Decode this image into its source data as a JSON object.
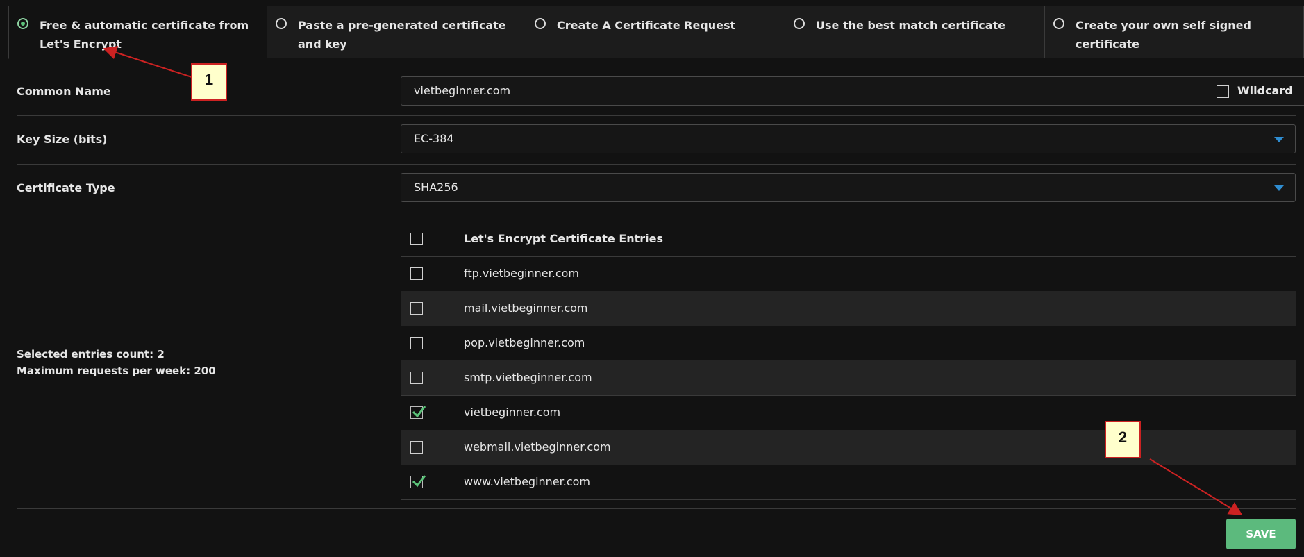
{
  "tabs": [
    {
      "label": "Free & automatic certificate from Let's Encrypt",
      "active": true
    },
    {
      "label": "Paste a pre-generated certificate and key",
      "active": false
    },
    {
      "label": "Create A Certificate Request",
      "active": false
    },
    {
      "label": "Use the best match certificate",
      "active": false
    },
    {
      "label": "Create your own self signed certificate",
      "active": false
    }
  ],
  "common_name": {
    "label": "Common Name",
    "value": "vietbeginner.com",
    "wildcard_label": "Wildcard",
    "wildcard_checked": false
  },
  "key_size": {
    "label": "Key Size (bits)",
    "value": "EC-384"
  },
  "cert_type": {
    "label": "Certificate Type",
    "value": "SHA256"
  },
  "entries": {
    "header": "Let's Encrypt Certificate Entries",
    "summary": {
      "count": "Selected entries count: 2",
      "max": "Maximum requests per week: 200"
    },
    "items": [
      {
        "name": "ftp.vietbeginner.com",
        "checked": false
      },
      {
        "name": "mail.vietbeginner.com",
        "checked": false
      },
      {
        "name": "pop.vietbeginner.com",
        "checked": false
      },
      {
        "name": "smtp.vietbeginner.com",
        "checked": false
      },
      {
        "name": "vietbeginner.com",
        "checked": true
      },
      {
        "name": "webmail.vietbeginner.com",
        "checked": false
      },
      {
        "name": "www.vietbeginner.com",
        "checked": true
      }
    ]
  },
  "save_label": "SAVE",
  "annotations": {
    "one": "1",
    "two": "2"
  },
  "colors": {
    "accent": "#5cba7d",
    "annotation_border": "#cc2222",
    "annotation_fill": "#ffffcc",
    "dropdown_arrow": "#2f8dd1"
  }
}
